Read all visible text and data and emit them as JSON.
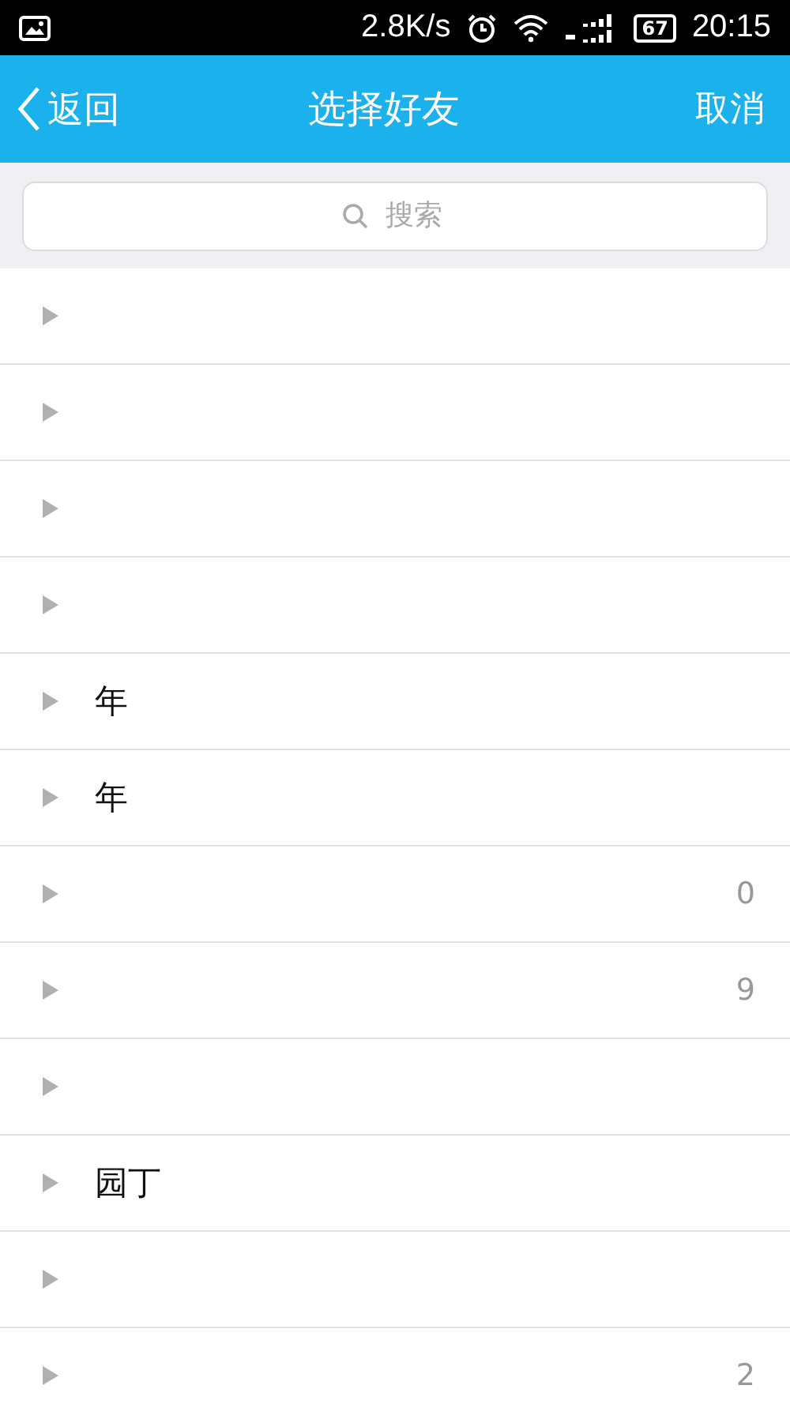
{
  "status_bar": {
    "net_speed": "2.8K/s",
    "battery": "67",
    "time": "20:15"
  },
  "header": {
    "back": "返回",
    "title": "选择好友",
    "cancel": "取消"
  },
  "search": {
    "placeholder": "搜索"
  },
  "groups": [
    {
      "expanded": false
    },
    {
      "expanded": false
    },
    {
      "expanded": false
    },
    {
      "expanded": false
    },
    {
      "name": "年",
      "expanded": false
    },
    {
      "name": "年",
      "expanded": false
    },
    {
      "count": "0",
      "expanded": false
    },
    {
      "count": "9",
      "expanded": false
    },
    {
      "expanded": false
    },
    {
      "name": "园丁",
      "expanded": false
    },
    {
      "expanded": false
    },
    {
      "count": "2",
      "expanded": false
    }
  ]
}
